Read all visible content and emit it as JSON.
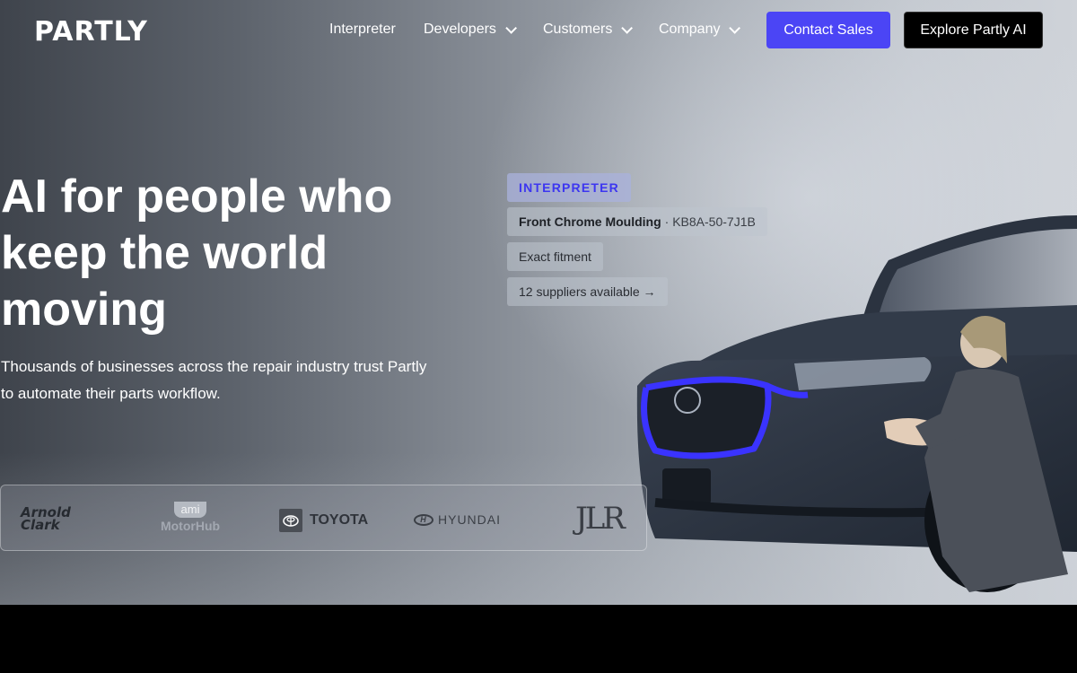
{
  "brand": {
    "logo_text": "PARTLY"
  },
  "nav": {
    "items": [
      {
        "label": "Interpreter",
        "has_dropdown": false
      },
      {
        "label": "Developers",
        "has_dropdown": true
      },
      {
        "label": "Customers",
        "has_dropdown": true
      },
      {
        "label": "Company",
        "has_dropdown": true
      }
    ],
    "contact_label": "Contact Sales",
    "explore_label": "Explore Partly AI"
  },
  "hero": {
    "headline": "AI for people who\nkeep the world\nmoving",
    "subtext": "Thousands of businesses across the repair industry trust Partly to automate their parts workflow."
  },
  "interpreter_card": {
    "tag": "INTERPRETER",
    "part_name": "Front Chrome Moulding",
    "part_code": "· KB8A-50-7J1B",
    "fitment": "Exact fitment",
    "suppliers": "12 suppliers available →"
  },
  "customers": {
    "arnold_clark": "Arnold Clark",
    "ami_top": "ami",
    "ami_bottom": "MotorHub",
    "toyota": "TOYOTA",
    "hyundai": "HYUNDAI",
    "jlr": "JLR"
  },
  "colors": {
    "accent": "#4b45f5",
    "tag_text": "#3d36f0",
    "highlight_outline": "#3a33ff"
  },
  "icons": [
    "chevron-down-icon",
    "right-arrow-icon",
    "toyota-emblem-icon",
    "hyundai-emblem-icon",
    "mazda-emblem-icon"
  ]
}
